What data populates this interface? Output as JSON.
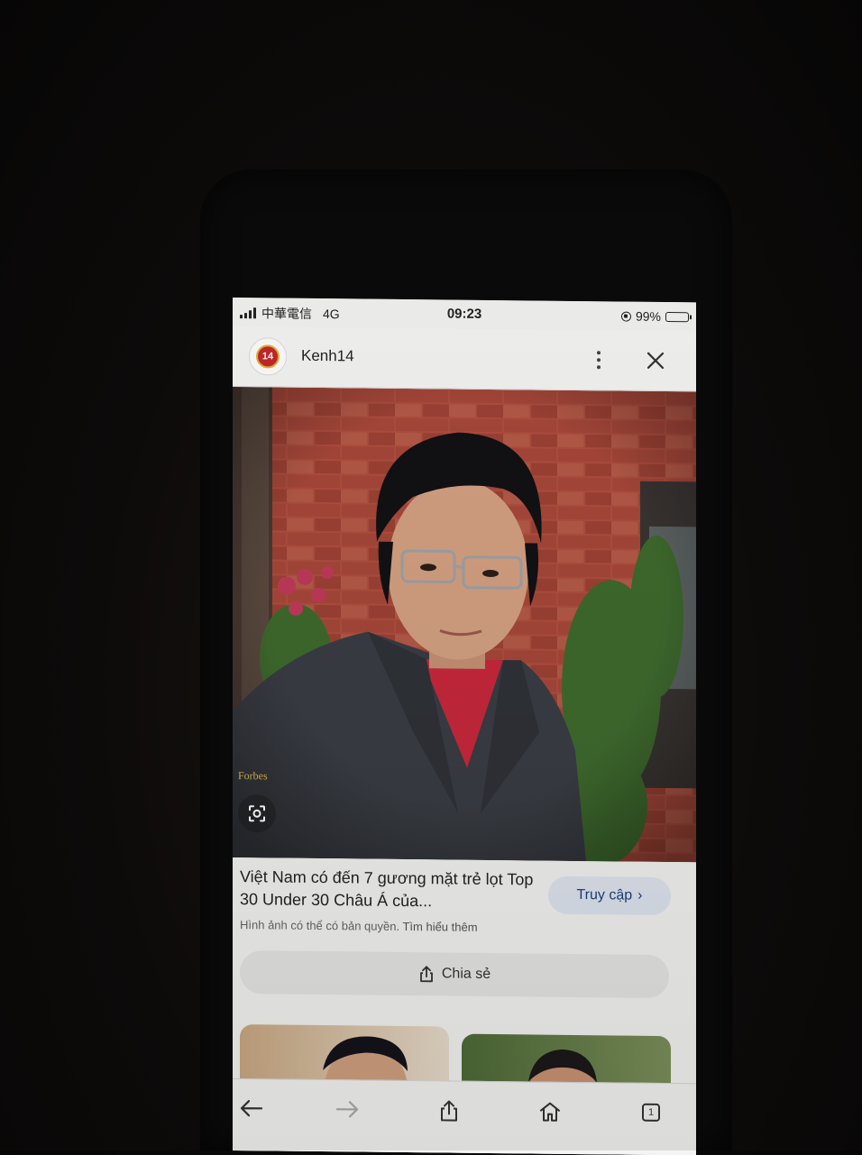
{
  "status_bar": {
    "carrier": "中華電信",
    "network": "4G",
    "time": "09:23",
    "battery": "99%"
  },
  "header": {
    "site_name": "Kenh14",
    "logo_text": "14",
    "more_icon": "more-vert-icon",
    "close_icon": "close-icon"
  },
  "image": {
    "watermark": "Forbes",
    "lens_icon": "google-lens-icon"
  },
  "result": {
    "title": "Việt Nam có đến 7 gương mặt trẻ lọt Top 30 Under 30 Châu Á của...",
    "visit_label": "Truy cập",
    "copyright_text": "Hình ảnh có thể có bản quyền.",
    "learn_more": "Tìm hiểu thêm",
    "share_label": "Chia sẻ"
  },
  "toolbar": {
    "back_icon": "back-arrow-icon",
    "forward_icon": "forward-arrow-icon",
    "share_icon": "share-icon",
    "home_icon": "home-icon",
    "tab_count": "1"
  },
  "colors": {
    "accent": "#1b3f7a",
    "visit_bg": "#dfe5ef",
    "logo_red": "#c4282b"
  }
}
